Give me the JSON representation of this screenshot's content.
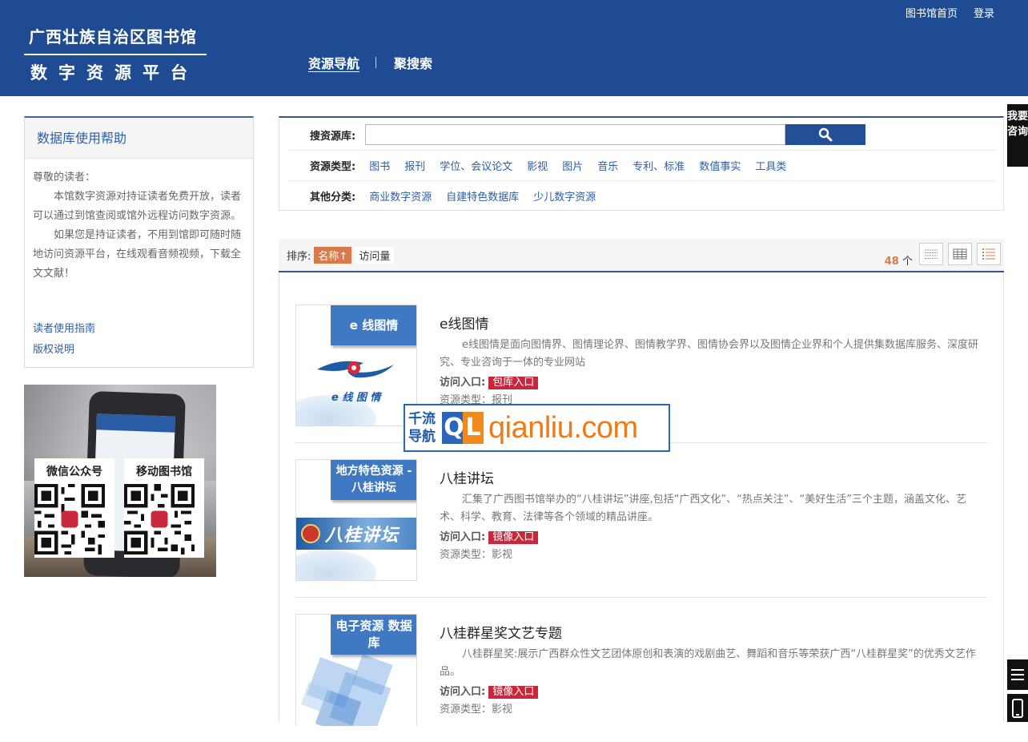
{
  "header": {
    "library_name": "广西壮族自治区图书馆",
    "platform_name": "数字资源平台",
    "top_links": [
      "图书馆首页",
      "登录"
    ],
    "nav": [
      {
        "label": "资源导航",
        "active": true
      },
      {
        "label": "聚搜索",
        "active": false
      }
    ]
  },
  "side_consult": "我要咨询",
  "help": {
    "title": "数据库使用帮助",
    "greeting": "尊敬的读者：",
    "para1": "本馆数字资源对持证读者免费开放，读者可以通过到馆查阅或馆外远程访问数字资源。",
    "para2": "如果您是持证读者，不用到馆即可随时随地访问资源平台，在线观看音频视频，下载全文文献！",
    "links": [
      "读者使用指南",
      "版权说明"
    ]
  },
  "promo": {
    "wechat_label": "微信公众号",
    "mobile_label": "移动图书馆"
  },
  "search": {
    "label": "搜资源库:",
    "value": "",
    "type_label": "资源类型:",
    "types": [
      "图书",
      "报刊",
      "学位、会议论文",
      "影视",
      "图片",
      "音乐",
      "专利、标准",
      "数值事实",
      "工具类"
    ],
    "other_label": "其他分类:",
    "others": [
      "商业数字资源",
      "自建特色数据库",
      "少儿数字资源"
    ]
  },
  "sort": {
    "label": "排序:",
    "by_name": "名称",
    "by_visits": "访问量",
    "count": "48",
    "count_unit": "个"
  },
  "items": [
    {
      "thumb_tag": "e 线图情",
      "thumb_logo_text": "e 线 图 情",
      "title": "e线图情",
      "desc": "e线图情是面向图情界、图情理论界、图情教学界、图情协会界以及图情企业界和个人提供集数据库服务、深度研究、专业咨询于一体的专业网站",
      "entry_label": "访问入口:",
      "entry_btn": "包库入口",
      "type": "资源类型：报刊"
    },
    {
      "thumb_tag": "地方特色资源 - 八桂讲坛",
      "thumb_banner": "八桂讲坛",
      "title": "八桂讲坛",
      "desc": "汇集了广西图书馆举办的“八桂讲坛”讲座,包括“广西文化”、“热点关注”、“美好生活”三个主题，涵盖文化、艺术、科学、教育、法律等各个领域的精品讲座。",
      "entry_label": "访问入口:",
      "entry_btn": "镜像入口",
      "type": "资源类型：影视"
    },
    {
      "thumb_tag": "电子资源 数据库",
      "title": "八桂群星奖文艺专题",
      "desc": "八桂群星奖:展示广西群众性文艺团体原创和表演的戏剧曲艺、舞蹈和音乐等荣获广西“八桂群星奖”的优秀文艺作品。",
      "entry_label": "访问入口:",
      "entry_btn": "镜像入口",
      "type": "资源类型：影视"
    }
  ],
  "watermark": {
    "cn_line1": "千流",
    "cn_line2": "导航",
    "logo_q": "Q",
    "logo_l": "L",
    "url": "qianliu.com"
  },
  "colors": {
    "header_bg": "#1e4b91",
    "link": "#2d5ea6",
    "accent_orange": "#d97a4a",
    "entry_red": "#c7283c"
  }
}
